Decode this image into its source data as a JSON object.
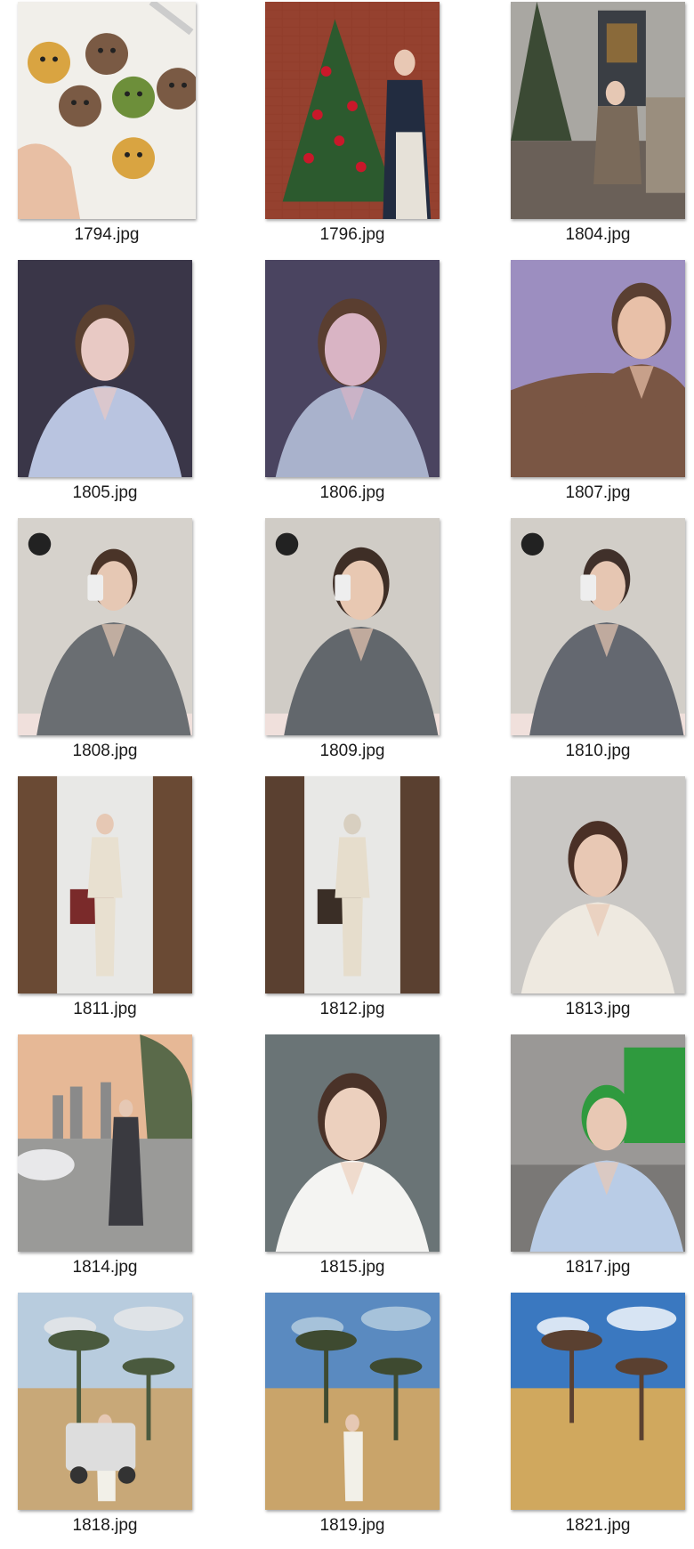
{
  "files": [
    {
      "name": "1794.jpg",
      "scene": "cookies",
      "colors": {
        "bg": "#f1efea",
        "a": "#d9a441",
        "b": "#7a5a44",
        "c": "#6d8f3a"
      }
    },
    {
      "name": "1796.jpg",
      "scene": "christmas-tree",
      "colors": {
        "bg": "#8a3b2a",
        "a": "#2c5a2e",
        "b": "#c9182a",
        "c": "#e6e1d8"
      }
    },
    {
      "name": "1804.jpg",
      "scene": "terrace",
      "colors": {
        "bg": "#a9a7a2",
        "a": "#3b4a34",
        "b": "#7a6a5a",
        "c": "#4a5058"
      }
    },
    {
      "name": "1805.jpg",
      "scene": "selfie-purple",
      "colors": {
        "bg": "#3a3648",
        "a": "#b9c4e0",
        "b": "#e8c9c4",
        "c": "#5a4030"
      }
    },
    {
      "name": "1806.jpg",
      "scene": "selfie-purple-close",
      "colors": {
        "bg": "#4a4460",
        "a": "#a9b2cc",
        "b": "#d9b4c4",
        "c": "#5a3e30"
      }
    },
    {
      "name": "1807.jpg",
      "scene": "makeup-cape",
      "colors": {
        "bg": "#9c8ec0",
        "a": "#7a5644",
        "b": "#e8c0a8",
        "c": "#5a3f32"
      }
    },
    {
      "name": "1808.jpg",
      "scene": "mirror-grey",
      "colors": {
        "bg": "#d6d2cc",
        "a": "#6a6e72",
        "b": "#e6c8b4",
        "c": "#4a3428"
      }
    },
    {
      "name": "1809.jpg",
      "scene": "mirror-grey-close",
      "colors": {
        "bg": "#d0ccc6",
        "a": "#62676c",
        "b": "#e8c8b2",
        "c": "#3e2e26"
      }
    },
    {
      "name": "1810.jpg",
      "scene": "mirror-grey",
      "colors": {
        "bg": "#d2cec8",
        "a": "#646870",
        "b": "#e6c6b2",
        "c": "#40302a"
      }
    },
    {
      "name": "1811.jpg",
      "scene": "mirror-frame",
      "colors": {
        "bg": "#6a4a34",
        "a": "#e8e0d0",
        "b": "#e6c8b4",
        "c": "#7a2a2a"
      }
    },
    {
      "name": "1812.jpg",
      "scene": "mirror-frame-wide",
      "colors": {
        "bg": "#5a4030",
        "a": "#e6ddcc",
        "b": "#d8cfc0",
        "c": "#3a2e26"
      }
    },
    {
      "name": "1813.jpg",
      "scene": "selfie-white-suit",
      "colors": {
        "bg": "#c9c7c4",
        "a": "#eee9e0",
        "b": "#e8c8b4",
        "c": "#4a3026"
      }
    },
    {
      "name": "1814.jpg",
      "scene": "city-sunset",
      "colors": {
        "bg": "#e6b896",
        "a": "#8a8a8a",
        "b": "#3a3a40",
        "c": "#5a6a4a"
      }
    },
    {
      "name": "1815.jpg",
      "scene": "selfie-white",
      "colors": {
        "bg": "#6a7476",
        "a": "#f4f4f2",
        "b": "#ecd0be",
        "c": "#4a3228"
      }
    },
    {
      "name": "1817.jpg",
      "scene": "studio-green",
      "colors": {
        "bg": "#9a9896",
        "a": "#b9cce6",
        "b": "#e8c8b4",
        "c": "#2f9a3e"
      }
    },
    {
      "name": "1818.jpg",
      "scene": "golf-cart",
      "colors": {
        "bg": "#b8ccde",
        "a": "#c8a878",
        "b": "#4a5a3e",
        "c": "#e8e8e8"
      }
    },
    {
      "name": "1819.jpg",
      "scene": "golf-field",
      "colors": {
        "bg": "#5a8ac0",
        "a": "#c9a46a",
        "b": "#3e4a30",
        "c": "#b9d0e0"
      }
    },
    {
      "name": "1821.jpg",
      "scene": "golf-trees",
      "colors": {
        "bg": "#3a78c0",
        "a": "#d0a85e",
        "b": "#5a4030",
        "c": "#ffffff"
      }
    }
  ]
}
